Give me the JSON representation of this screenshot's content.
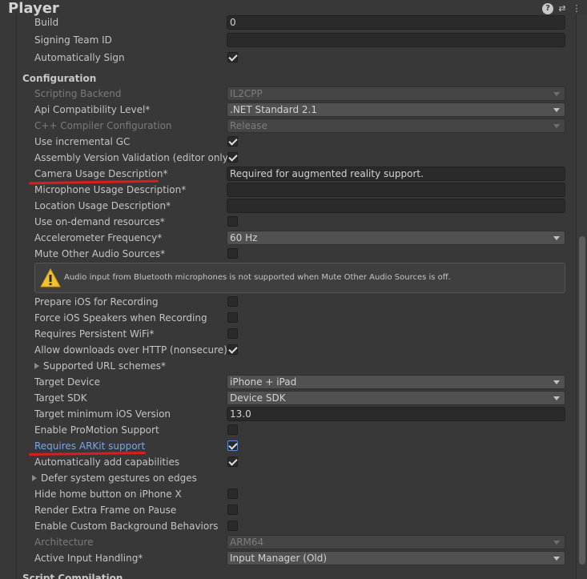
{
  "window": {
    "title": "Player",
    "icons": [
      "help-icon",
      "preset-icon",
      "more-icon"
    ]
  },
  "rows": {
    "build": {
      "label": "Build",
      "value": "0"
    },
    "signing_team": {
      "label": "Signing Team ID",
      "value": ""
    },
    "auto_sign": {
      "label": "Automatically Sign",
      "checked": true
    },
    "configuration": {
      "label": "Configuration"
    },
    "scripting_backend": {
      "label": "Scripting Backend",
      "value": "IL2CPP"
    },
    "api_level": {
      "label": "Api Compatibility Level*",
      "value": ".NET Standard 2.1"
    },
    "cpp_config": {
      "label": "C++ Compiler Configuration",
      "value": "Release"
    },
    "incremental_gc": {
      "label": "Use incremental GC",
      "checked": true
    },
    "assembly_validation": {
      "label": "Assembly Version Validation (editor only)",
      "checked": true
    },
    "camera_usage": {
      "label": "Camera Usage Description*",
      "value": "Required for augmented reality support."
    },
    "microphone_usage": {
      "label": "Microphone Usage Description*",
      "value": ""
    },
    "location_usage": {
      "label": "Location Usage Description*",
      "value": ""
    },
    "on_demand": {
      "label": "Use on-demand resources*",
      "checked": false
    },
    "accelerometer": {
      "label": "Accelerometer Frequency*",
      "value": "60 Hz"
    },
    "mute_audio": {
      "label": "Mute Other Audio Sources*",
      "checked": false
    },
    "warning": {
      "text": "Audio input from Bluetooth microphones is not supported when Mute Other Audio Sources is off."
    },
    "prepare_recording": {
      "label": "Prepare iOS for Recording",
      "checked": false
    },
    "force_speakers": {
      "label": "Force iOS Speakers when Recording",
      "checked": false
    },
    "persistent_wifi": {
      "label": "Requires Persistent WiFi*",
      "checked": false
    },
    "allow_http": {
      "label": "Allow downloads over HTTP (nonsecure)*",
      "checked": true
    },
    "url_schemes": {
      "label": "Supported URL schemes*"
    },
    "target_device": {
      "label": "Target Device",
      "value": "iPhone + iPad"
    },
    "target_sdk": {
      "label": "Target SDK",
      "value": "Device SDK"
    },
    "min_ios": {
      "label": "Target minimum iOS Version",
      "value": "13.0"
    },
    "promotion": {
      "label": "Enable ProMotion Support",
      "checked": false
    },
    "arkit": {
      "label": "Requires ARKit support",
      "checked": true
    },
    "auto_capabilities": {
      "label": "Automatically add capabilities",
      "checked": true
    },
    "defer_gestures": {
      "label": "Defer system gestures on edges"
    },
    "hide_home": {
      "label": "Hide home button on iPhone X",
      "checked": false
    },
    "extra_frame": {
      "label": "Render Extra Frame on Pause",
      "checked": false
    },
    "custom_bg": {
      "label": "Enable Custom Background Behaviors",
      "checked": false
    },
    "architecture": {
      "label": "Architecture",
      "value": "ARM64"
    },
    "input_handling": {
      "label": "Active Input Handling*",
      "value": "Input Manager (Old)"
    },
    "script_compilation": {
      "label": "Script Compilation"
    }
  },
  "colors": {
    "background": "#383838",
    "field": "#2a2a2a",
    "dropdown": "#515151",
    "highlight_label": "#7aa5e6",
    "annotation": "#d81e1e"
  }
}
